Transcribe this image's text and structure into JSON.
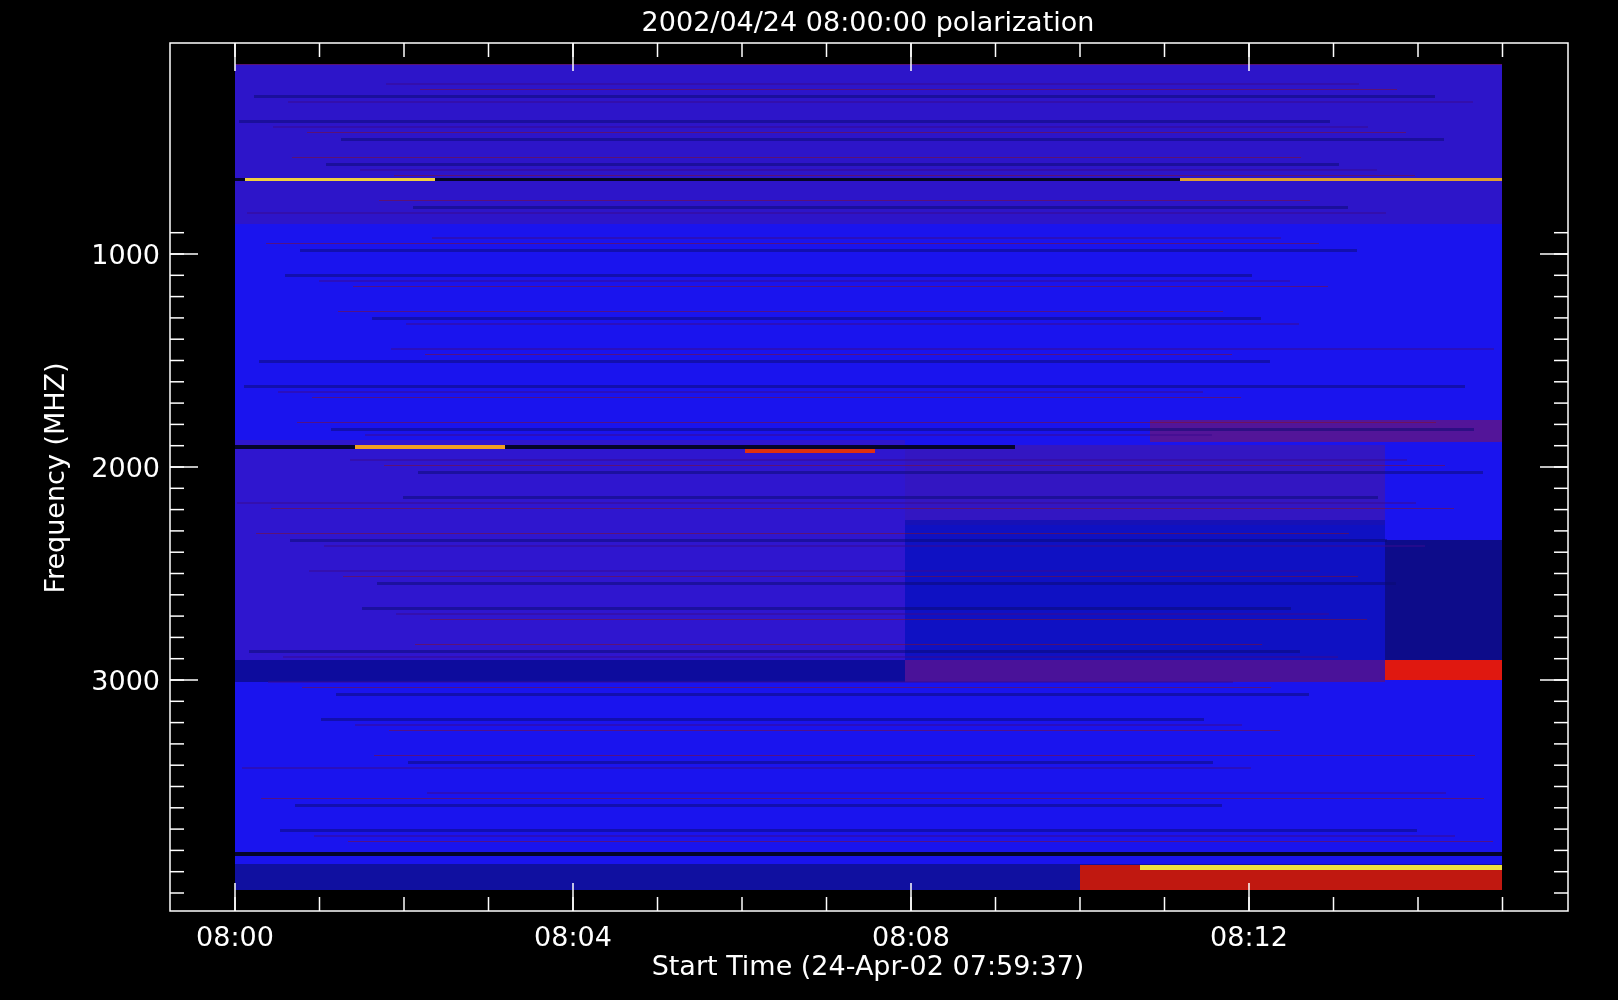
{
  "plot": {
    "title": "2002/04/24 08:00:00 polarization",
    "xlabel": "Start Time (24-Apr-02 07:59:37)",
    "ylabel": "Frequency (MHZ)",
    "yticks": [
      "1000",
      "2000",
      "3000"
    ],
    "xticks": [
      "08:00",
      "08:04",
      "08:08",
      "08:12"
    ]
  }
}
